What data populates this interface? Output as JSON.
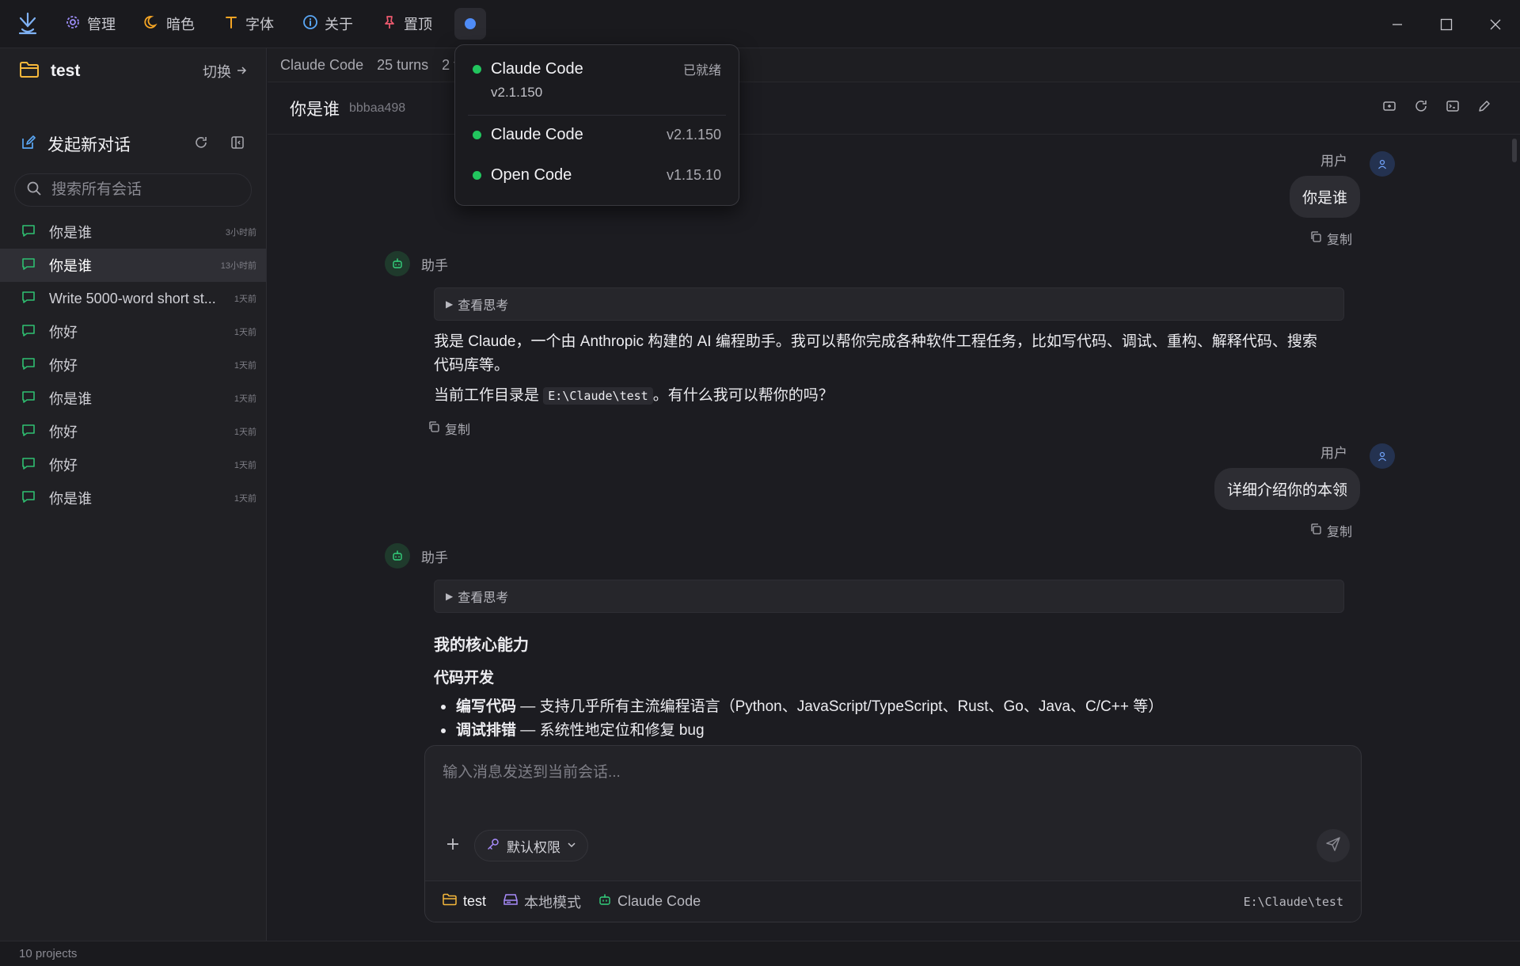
{
  "titlebar": {
    "menu": [
      {
        "label": "管理",
        "icon": "gear-icon"
      },
      {
        "label": "暗色",
        "icon": "moon-icon"
      },
      {
        "label": "字体",
        "icon": "font-icon"
      },
      {
        "label": "关于",
        "icon": "info-icon"
      },
      {
        "label": "置顶",
        "icon": "pin-icon"
      }
    ]
  },
  "sidebar": {
    "project_name": "test",
    "switch_label": "切换",
    "new_chat_label": "发起新对话",
    "search_placeholder": "搜索所有会话",
    "conversations": [
      {
        "title": "你是谁",
        "time": "3小时前",
        "active": false
      },
      {
        "title": "你是谁",
        "time": "13小时前",
        "active": true
      },
      {
        "title": "Write 5000-word short st...",
        "time": "1天前",
        "active": false
      },
      {
        "title": "你好",
        "time": "1天前",
        "active": false
      },
      {
        "title": "你好",
        "time": "1天前",
        "active": false
      },
      {
        "title": "你是谁",
        "time": "1天前",
        "active": false
      },
      {
        "title": "你好",
        "time": "1天前",
        "active": false
      },
      {
        "title": "你好",
        "time": "1天前",
        "active": false
      },
      {
        "title": "你是谁",
        "time": "1天前",
        "active": false
      }
    ]
  },
  "statusbar": {
    "projects": "10 projects"
  },
  "tabstrip": {
    "items": [
      "Claude Code",
      "25 turns",
      "2 f"
    ]
  },
  "conversation": {
    "title": "你是谁",
    "id": "bbbaa498"
  },
  "messages": {
    "user_label": "用户",
    "assistant_label": "助手",
    "copy_label": "复制",
    "think_label": "查看思考",
    "user1": "你是谁",
    "asst1_p1": "我是 Claude，一个由 Anthropic 构建的 AI 编程助手。我可以帮你完成各种软件工程任务，比如写代码、调试、重构、解释代码、搜索代码库等。",
    "asst1_p2_before": "当前工作目录是 ",
    "asst1_p2_code": "E:\\Claude\\test",
    "asst1_p2_after": "。有什么我可以帮你的吗？",
    "user2": "详细介绍你的本领",
    "asst2_h3": "我的核心能力",
    "asst2_h4": "代码开发",
    "asst2_li1_bold": "编写代码",
    "asst2_li1_text": " — 支持几乎所有主流编程语言（Python、JavaScript/TypeScript、Rust、Go、Java、C/C++ 等）",
    "asst2_li2_bold": "调试排错",
    "asst2_li2_text": " — 系统性地定位和修复 bug"
  },
  "composer": {
    "placeholder": "输入消息发送到当前会话...",
    "permission_label": "默认权限",
    "footer_project": "test",
    "footer_mode": "本地模式",
    "footer_runtime": "Claude Code",
    "footer_path": "E:\\Claude\\test"
  },
  "runtime_dropdown": {
    "items": [
      {
        "name": "Claude Code",
        "meta": "已就绪",
        "sub": "v2.1.150"
      },
      {
        "name": "Claude Code",
        "meta": "v2.1.150"
      },
      {
        "name": "Open Code",
        "meta": "v1.15.10"
      }
    ]
  },
  "colors": {
    "accent": "#4f8cf7",
    "status_ok": "#22c55e",
    "folder": "#f5b73b"
  }
}
